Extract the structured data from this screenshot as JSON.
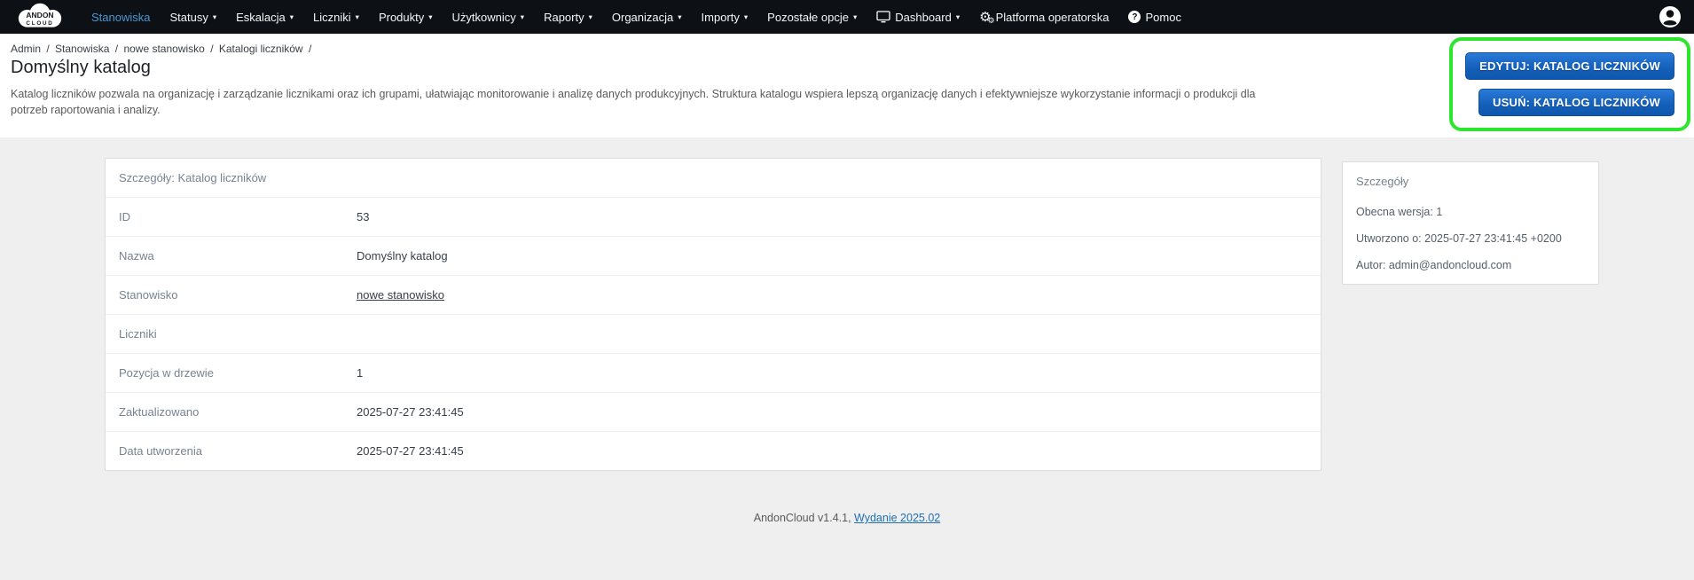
{
  "colors": {
    "nav_bg": "#0d1014",
    "nav_active_blue": "#4a98d3",
    "button_blue": "#1a63c4",
    "highlight_green": "#2ce52c",
    "link_blue": "#1f6db5"
  },
  "navbar": {
    "logo": {
      "line1": "ANDON",
      "line2": "CLOUD"
    },
    "icons": {
      "caret": "▾",
      "gear": "⚙",
      "help": "?"
    },
    "items": [
      {
        "label": "Stanowiska"
      },
      {
        "label": "Statusy"
      },
      {
        "label": "Eskalacja"
      },
      {
        "label": "Liczniki"
      },
      {
        "label": "Produkty"
      },
      {
        "label": "Użytkownicy"
      },
      {
        "label": "Raporty"
      },
      {
        "label": "Organizacja"
      },
      {
        "label": "Importy"
      },
      {
        "label": "Pozostałe opcje"
      },
      {
        "label": "Dashboard"
      },
      {
        "label": "Platforma operatorska"
      },
      {
        "label": "Pomoc"
      }
    ]
  },
  "breadcrumb": {
    "separator": "/",
    "items": [
      "Admin",
      "Stanowiska",
      "nowe stanowisko",
      "Katalogi liczników"
    ]
  },
  "page": {
    "title": "Domyślny katalog",
    "description": "Katalog liczników pozwala na organizację i zarządzanie licznikami oraz ich grupami, ułatwiając monitorowanie i analizę danych produkcyjnych. Struktura katalogu wspiera lepszą organizację danych i efektywniejsze wykorzystanie informacji o produkcji dla potrzeb raportowania i analizy."
  },
  "actions": {
    "edit_label": "EDYTUJ: KATALOG LICZNIKÓW",
    "delete_label": "USUŃ: KATALOG LICZNIKÓW"
  },
  "details_card": {
    "header": "Szczegóły: Katalog liczników",
    "rows": [
      {
        "label": "ID",
        "value": "53"
      },
      {
        "label": "Nazwa",
        "value": "Domyślny katalog"
      },
      {
        "label": "Stanowisko",
        "value": "nowe stanowisko"
      },
      {
        "label": "Liczniki",
        "value": ""
      },
      {
        "label": "Pozycja w drzewie",
        "value": "1"
      },
      {
        "label": "Zaktualizowano",
        "value": "2025-07-27 23:41:45"
      },
      {
        "label": "Data utworzenia",
        "value": "2025-07-27 23:41:45"
      }
    ]
  },
  "side_panel": {
    "header": "Szczegóły",
    "lines": [
      "Obecna wersja: 1",
      "Utworzono o: 2025-07-27 23:41:45 +0200",
      "Autor: admin@andoncloud.com"
    ]
  },
  "footer": {
    "text": "AndonCloud v1.4.1,",
    "link_label": "Wydanie 2025.02"
  }
}
